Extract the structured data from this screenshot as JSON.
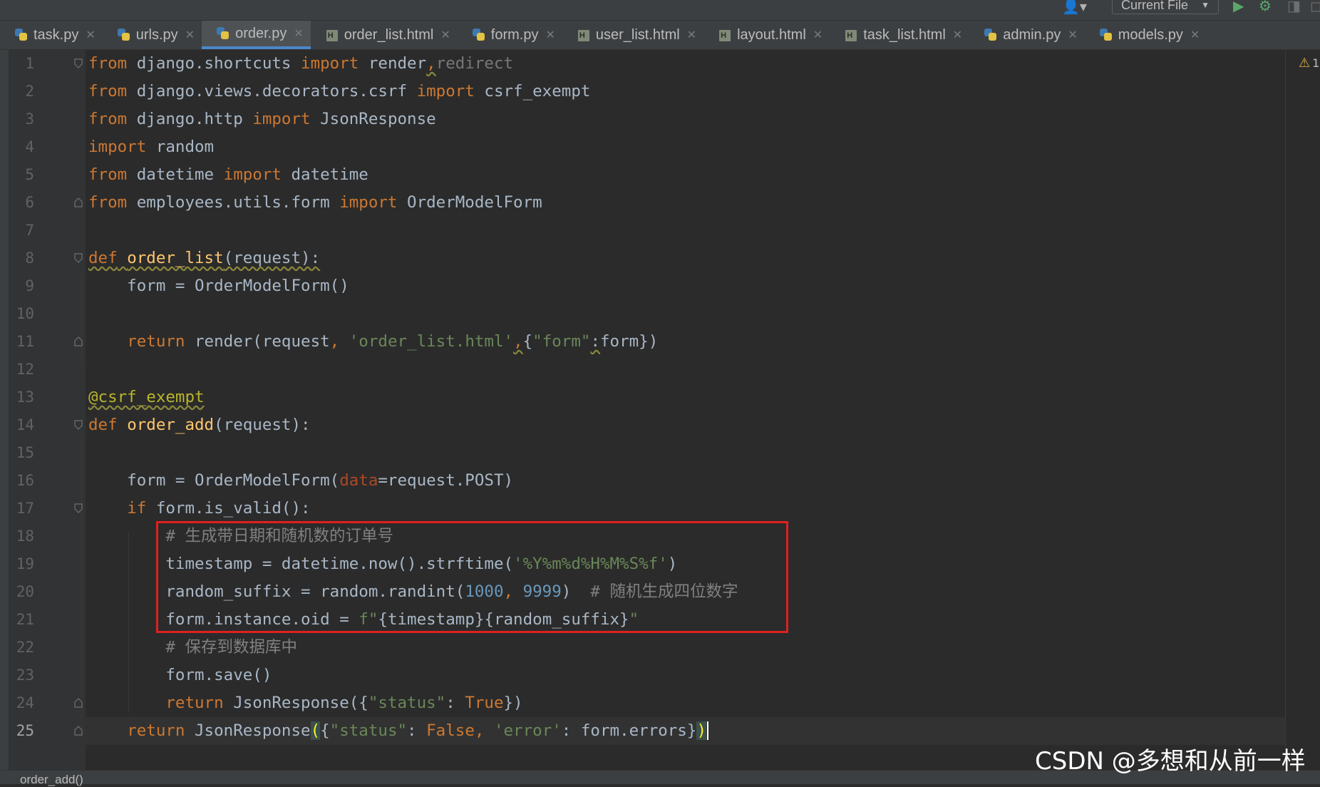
{
  "toolbar": {
    "run_config": "Current File",
    "user_icon": "user-icon",
    "run_icon": "run-icon",
    "debug_icon": "debug-icon",
    "coverage_icon": "coverage-icon"
  },
  "tabs": [
    {
      "label": "task.py",
      "type": "py",
      "active": false
    },
    {
      "label": "urls.py",
      "type": "py",
      "active": false
    },
    {
      "label": "order.py",
      "type": "py",
      "active": true
    },
    {
      "label": "order_list.html",
      "type": "html",
      "active": false
    },
    {
      "label": "form.py",
      "type": "py",
      "active": false
    },
    {
      "label": "user_list.html",
      "type": "html",
      "active": false
    },
    {
      "label": "layout.html",
      "type": "html",
      "active": false
    },
    {
      "label": "task_list.html",
      "type": "html",
      "active": false
    },
    {
      "label": "admin.py",
      "type": "py",
      "active": false
    },
    {
      "label": "models.py",
      "type": "py",
      "active": false
    }
  ],
  "editor": {
    "current_line": 25,
    "inspection_warnings": "1",
    "line_numbers": [
      "1",
      "2",
      "3",
      "4",
      "5",
      "6",
      "7",
      "8",
      "9",
      "10",
      "11",
      "12",
      "13",
      "14",
      "15",
      "16",
      "17",
      "18",
      "19",
      "20",
      "21",
      "22",
      "23",
      "24",
      "25"
    ],
    "code": {
      "l1": {
        "a": "from",
        "b": " django.shortcuts ",
        "c": "import",
        "d": " render",
        "e": ",",
        "f": "redirect"
      },
      "l2": {
        "a": "from",
        "b": " django.views.decorators.csrf ",
        "c": "import",
        "d": " csrf_exempt"
      },
      "l3": {
        "a": "from",
        "b": " django.http ",
        "c": "import",
        "d": " JsonResponse"
      },
      "l4": {
        "a": "import",
        "b": " random"
      },
      "l5": {
        "a": "from",
        "b": " datetime ",
        "c": "import",
        "d": " datetime"
      },
      "l6": {
        "a": "from",
        "b": " employees.utils.form ",
        "c": "import",
        "d": " OrderModelForm"
      },
      "l8": {
        "a": "def",
        "b": "order_list",
        "c": "(request):"
      },
      "l9": {
        "a": "    form = OrderModelForm()"
      },
      "l11": {
        "a": "return",
        "b": " render(request",
        "c": ", ",
        "d": "'order_list.html'",
        "e": ",",
        "f": "{",
        "g": "\"form\"",
        "h": ":",
        "i": "form})"
      },
      "l13": {
        "a": "@csrf_exempt"
      },
      "l14": {
        "a": "def",
        "b": "order_add",
        "c": "(request):"
      },
      "l16": {
        "a": "    form = OrderModelForm(",
        "b": "data",
        "c": "=request.POST)"
      },
      "l17": {
        "a": "if",
        "b": " form.is_valid():"
      },
      "l18": {
        "a": "# 生成带日期和随机数的订单号"
      },
      "l19": {
        "a": "timestamp = datetime.now().strftime(",
        "b": "'%Y%m%d%H%M%S%f'",
        "c": ")"
      },
      "l20": {
        "a": "random_suffix = random.randint(",
        "b": "1000",
        "c": ", ",
        "d": "9999",
        "e": ")  ",
        "f": "# 随机生成四位数字"
      },
      "l21": {
        "a": "form.instance.oid = ",
        "b": "f\"",
        "c": "{timestamp}{random_suffix}",
        "d": "\""
      },
      "l22": {
        "a": "# 保存到数据库中"
      },
      "l23": {
        "a": "form.save()"
      },
      "l24": {
        "a": "return",
        "b": " JsonResponse({",
        "c": "\"status\"",
        "d": ": ",
        "e": "True",
        "f": "})"
      },
      "l25": {
        "a": "return",
        "b": " JsonResponse",
        "c": "(",
        "d": "{",
        "e": "\"status\"",
        "f": ": ",
        "g": "False",
        "h": ", ",
        "i": "'error'",
        "j": ": form.errors}",
        "k": ")"
      }
    }
  },
  "breadcrumb": "order_add()",
  "watermark": "CSDN @多想和从前一样",
  "colors": {
    "background": "#2b2b2b",
    "keyword": "#cc7832",
    "function": "#ffc66d",
    "string": "#6a8759",
    "number": "#6897bb",
    "comment": "#808080",
    "decorator": "#bbb529",
    "highlight_box": "#e02020"
  }
}
